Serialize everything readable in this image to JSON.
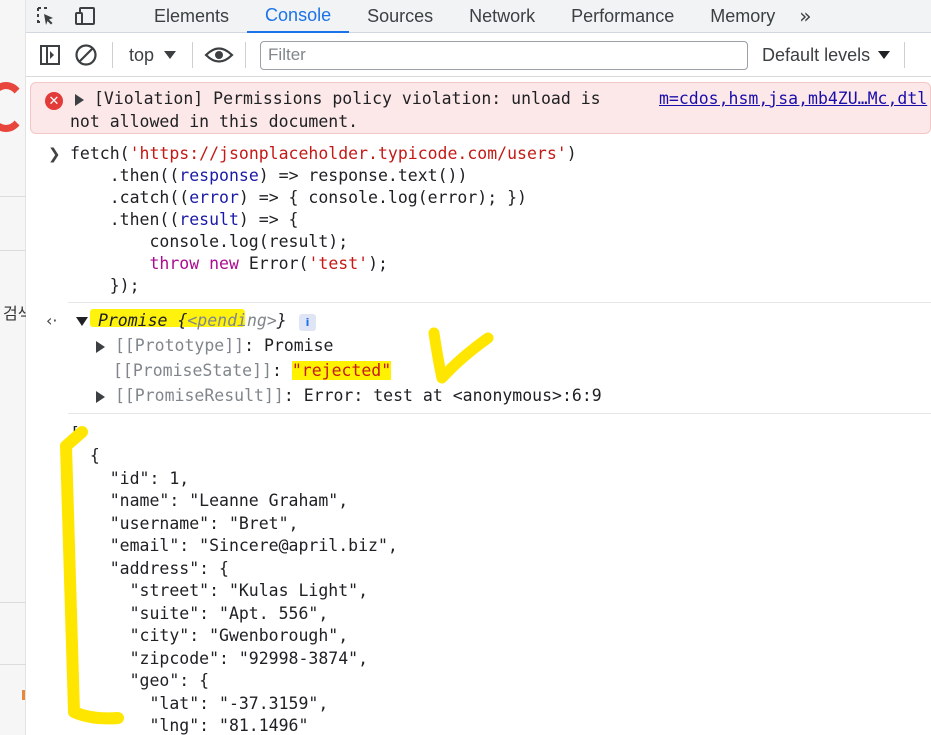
{
  "tabs": {
    "items": [
      "Elements",
      "Console",
      "Sources",
      "Network",
      "Performance",
      "Memory"
    ],
    "active": "Console",
    "more": "»"
  },
  "toolbar": {
    "context": "top",
    "filter_placeholder": "Filter",
    "levels": "Default levels"
  },
  "left_strip": {
    "text": "검색"
  },
  "violation": {
    "line1": "[Violation] Permissions policy violation: unload is",
    "line2": "not allowed in this document.",
    "source_link": "m=cdos,hsm,jsa,mb4ZU…Mc,dtl"
  },
  "input": {
    "l1_a": "fetch(",
    "l1_str": "'https://jsonplaceholder.typicode.com/users'",
    "l1_b": ")",
    "l2_a": "    .then((",
    "l2_var": "response",
    "l2_b": ") => response.text())",
    "l3_a": "    .catch((",
    "l3_var": "error",
    "l3_b": ") => { console.log(error); })",
    "l4_a": "    .then((",
    "l4_var": "result",
    "l4_b": ") => {",
    "l5": "        console.log(result);",
    "l6_indent": "        ",
    "l6_kw1": "throw",
    "l6_sp": " ",
    "l6_kw2": "new",
    "l6_a": " Error(",
    "l6_str": "'test'",
    "l6_b": ");",
    "l7": "    });"
  },
  "result": {
    "promise_a": "Promise {",
    "promise_pending": "<pending>",
    "promise_b": "}",
    "info": "i",
    "prototype_key": "[[Prototype]]",
    "prototype_val": ": Promise",
    "state_key": "[[PromiseState]]",
    "state_sep": ": ",
    "state_val": "\"rejected\"",
    "result_key": "[[PromiseResult]]",
    "result_val": ": Error: test at <anonymous>:6:9"
  },
  "json_output": [
    "[",
    "  {",
    "    \"id\": 1,",
    "    \"name\": \"Leanne Graham\",",
    "    \"username\": \"Bret\",",
    "    \"email\": \"Sincere@april.biz\",",
    "    \"address\": {",
    "      \"street\": \"Kulas Light\",",
    "      \"suite\": \"Apt. 556\",",
    "      \"city\": \"Gwenborough\",",
    "      \"zipcode\": \"92998-3874\",",
    "      \"geo\": {",
    "        \"lat\": \"-37.3159\",",
    "        \"lng\": \"81.1496\""
  ],
  "colors": {
    "accent": "#1a73e8",
    "error": "#e33a3a",
    "string": "#c41a16",
    "variable": "#1a1aa6",
    "keyword": "#aa0d91",
    "highlight": "#fff200"
  }
}
